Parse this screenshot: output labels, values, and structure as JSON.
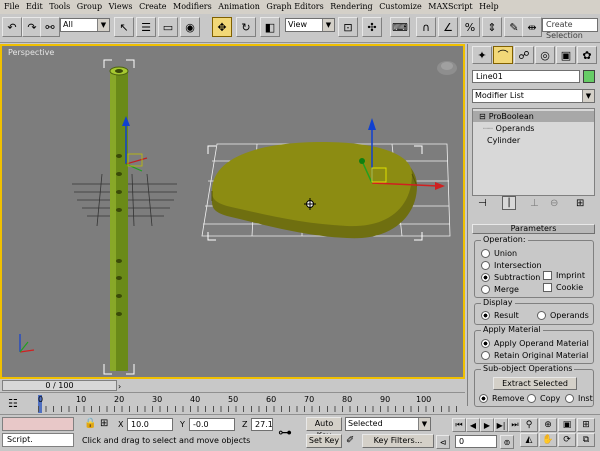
{
  "menu": {
    "items": [
      "File",
      "Edit",
      "Tools",
      "Group",
      "Views",
      "Create",
      "Modifiers",
      "Animation",
      "Graph Editors",
      "Rendering",
      "Customize",
      "MAXScript",
      "Help"
    ]
  },
  "toolbar": {
    "selection_filter": "All",
    "reference_coord": "View",
    "named_selection_placeholder": "Create Selection"
  },
  "viewport": {
    "label": "Perspective",
    "accent": "#f0c000"
  },
  "command_panel": {
    "object_name": "Line01",
    "object_color": "#66cc66",
    "modifier_list": "Modifier List",
    "stack": [
      {
        "label": "ProBoolean",
        "selected": true
      },
      {
        "label": "Operands",
        "selected": false
      },
      {
        "label": "Cylinder",
        "selected": false
      }
    ],
    "rollout_title": "Parameters",
    "operation": {
      "title": "Operation:",
      "options": [
        "Union",
        "Intersection",
        "Subtraction",
        "Merge"
      ],
      "selected": "Subtraction",
      "checks": [
        "Imprint",
        "Cookie"
      ]
    },
    "display": {
      "title": "Display",
      "options": [
        "Result",
        "Operands"
      ],
      "selected": "Result"
    },
    "apply_material": {
      "title": "Apply Material",
      "options": [
        "Apply Operand Material",
        "Retain Original Material"
      ],
      "selected": "Apply Operand Material"
    },
    "subobject": {
      "title": "Sub-object Operations",
      "button": "Extract Selected",
      "options": [
        "Remove",
        "Copy",
        "Inst"
      ],
      "selected": "Remove"
    }
  },
  "timeline": {
    "frame_readout": "0 / 100",
    "ticks": [
      "0",
      "10",
      "20",
      "30",
      "40",
      "50",
      "60",
      "70",
      "80",
      "90",
      "100"
    ]
  },
  "status": {
    "script_label": "Script.",
    "x_label": "X",
    "x_value": "10.0",
    "y_label": "Y",
    "y_value": "-0.0",
    "z_label": "Z",
    "z_value": "27.14",
    "prompt": "Click and drag to select and move objects",
    "auto_key": "Auto Key",
    "set_key": "Set Key",
    "key_mode": "Selected",
    "key_filters": "Key Filters...",
    "current_frame": "0"
  }
}
